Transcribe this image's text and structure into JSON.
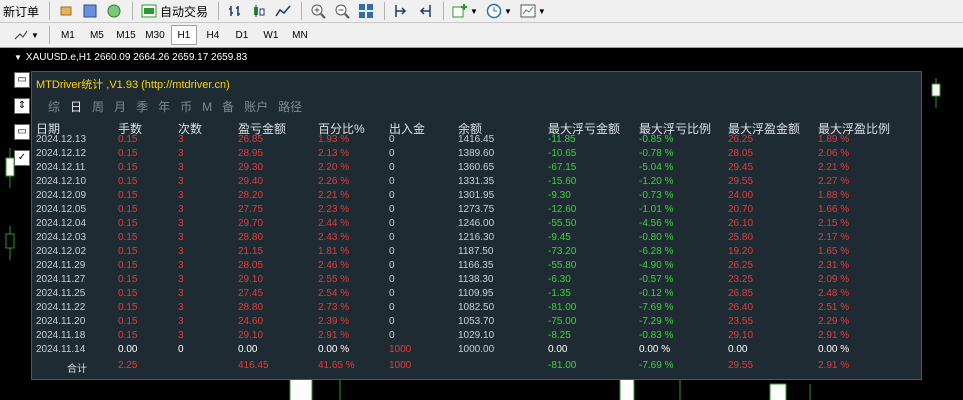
{
  "toolbar": {
    "new_order_label": "新订单",
    "auto_trade_label": "自动交易",
    "timeframes": [
      "M1",
      "M5",
      "M15",
      "M30",
      "H1",
      "H4",
      "D1",
      "W1",
      "MN"
    ],
    "active_timeframe": "H1"
  },
  "chart": {
    "symbol_line": "XAUUSD.e,H1  2660.09 2664.26 2659.17 2659.83"
  },
  "panel": {
    "title": "MTDriver统计 ,V1.93 (http://mtdriver.cn)",
    "tabs": [
      "综",
      "日",
      "周",
      "月",
      "季",
      "年",
      "币",
      "M",
      "备",
      "账户",
      "路径"
    ],
    "active_tab": "日",
    "headers": [
      "日期",
      "手数",
      "次数",
      "盈亏金额",
      "百分比%",
      "出入金",
      "余额",
      "最大浮亏金额",
      "最大浮亏比例",
      "最大浮盈金额",
      "最大浮盈比例"
    ],
    "rows": [
      [
        "2024.12.13",
        "0.15",
        "3",
        "26.85",
        "1.93 %",
        "0",
        "1416.45",
        "-11.85",
        "-0.85 %",
        "26.25",
        "1.89 %"
      ],
      [
        "2024.12.12",
        "0.15",
        "3",
        "28.95",
        "2.13 %",
        "0",
        "1389.60",
        "-10.65",
        "-0.78 %",
        "28.05",
        "2.06 %"
      ],
      [
        "2024.12.11",
        "0.15",
        "3",
        "29.30",
        "2.20 %",
        "0",
        "1360.65",
        "-67.15",
        "-5.04 %",
        "29.45",
        "2.21 %"
      ],
      [
        "2024.12.10",
        "0.15",
        "3",
        "29.40",
        "2.26 %",
        "0",
        "1331.35",
        "-15.60",
        "-1.20 %",
        "29.55",
        "2.27 %"
      ],
      [
        "2024.12.09",
        "0.15",
        "3",
        "28.20",
        "2.21 %",
        "0",
        "1301.95",
        "-9.30",
        "-0.73 %",
        "24.00",
        "1.88 %"
      ],
      [
        "2024.12.05",
        "0.15",
        "3",
        "27.75",
        "2.23 %",
        "0",
        "1273.75",
        "-12.60",
        "-1.01 %",
        "20.70",
        "1.66 %"
      ],
      [
        "2024.12.04",
        "0.15",
        "3",
        "29.70",
        "2.44 %",
        "0",
        "1246.00",
        "-55.50",
        "-4.56 %",
        "26.10",
        "2.15 %"
      ],
      [
        "2024.12.03",
        "0.15",
        "3",
        "28.80",
        "2.43 %",
        "0",
        "1216.30",
        "-9.45",
        "-0.80 %",
        "25.80",
        "2.17 %"
      ],
      [
        "2024.12.02",
        "0.15",
        "3",
        "21.15",
        "1.81 %",
        "0",
        "1187.50",
        "-73.20",
        "-6.28 %",
        "19.20",
        "1.65 %"
      ],
      [
        "2024.11.29",
        "0.15",
        "3",
        "28.05",
        "2.46 %",
        "0",
        "1166.35",
        "-55.80",
        "-4.90 %",
        "26.25",
        "2.31 %"
      ],
      [
        "2024.11.27",
        "0.15",
        "3",
        "29.10",
        "2.55 %",
        "0",
        "1138.30",
        "-6.30",
        "-0.57 %",
        "23.25",
        "2.09 %"
      ],
      [
        "2024.11.25",
        "0.15",
        "3",
        "27.45",
        "2.54 %",
        "0",
        "1109.95",
        "-1.35",
        "-0.12 %",
        "26.85",
        "2.48 %"
      ],
      [
        "2024.11.22",
        "0.15",
        "3",
        "28.80",
        "2.73 %",
        "0",
        "1082.50",
        "-81.00",
        "-7.69 %",
        "26.40",
        "2.51 %"
      ],
      [
        "2024.11.20",
        "0.15",
        "3",
        "24.60",
        "2.39 %",
        "0",
        "1053.70",
        "-75.00",
        "-7.29 %",
        "23.55",
        "2.29 %"
      ],
      [
        "2024.11.18",
        "0.15",
        "3",
        "29.10",
        "2.91 %",
        "0",
        "1029.10",
        "-8.25",
        "-0.83 %",
        "29.10",
        "2.91 %"
      ],
      [
        "2024.11.14",
        "0.00",
        "0",
        "0.00",
        "0.00 %",
        "1000",
        "1000.00",
        "0.00",
        "0.00 %",
        "0.00",
        "0.00 %"
      ]
    ],
    "total": {
      "label": "合计",
      "lots": "2.25",
      "profit": "416.45",
      "percent": "41.65 %",
      "deposit": "1000",
      "max_float_loss": "-81.00",
      "max_float_loss_pct": "-7.69 %",
      "max_float_profit": "29.55",
      "max_float_profit_pct": "2.91 %"
    },
    "colors": {
      "red": "#e33b3b",
      "green": "#3ad43a",
      "white": "#ffffff",
      "grey": "#c8d0d6",
      "header": "#d9e0e5"
    }
  }
}
